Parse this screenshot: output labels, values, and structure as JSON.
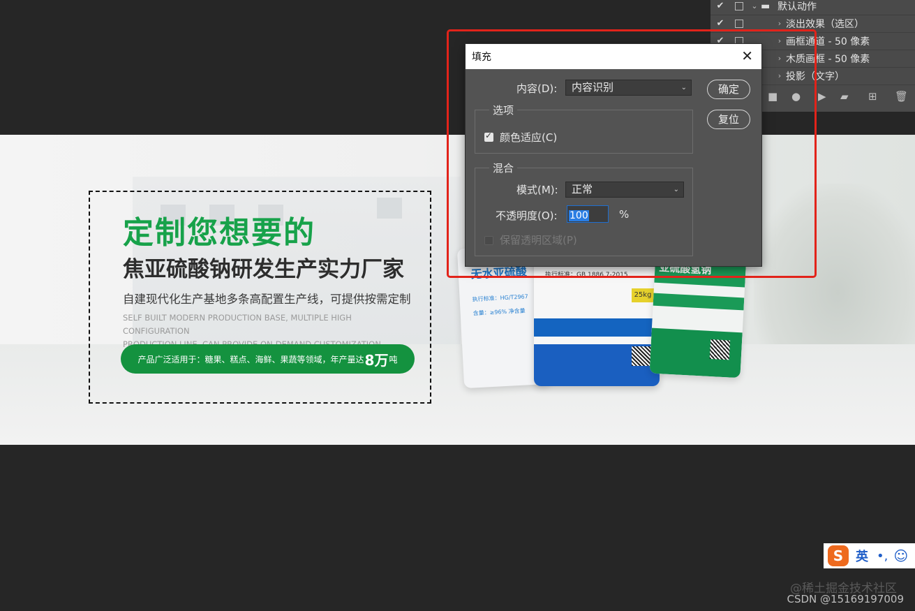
{
  "actions_panel": {
    "rows": [
      {
        "name": "默认动作",
        "kind": "folder"
      },
      {
        "name": "淡出效果（选区）",
        "kind": "action"
      },
      {
        "name": "画框通道 - 50 像素",
        "kind": "action"
      },
      {
        "name": "木质画框 - 50 像素",
        "kind": "action"
      },
      {
        "name": "投影（文字）",
        "kind": "action"
      }
    ],
    "check_mark": "✔"
  },
  "dialog": {
    "title": "填充",
    "close_glyph": "✕",
    "content_label": "内容(D):",
    "content_value": "内容识别",
    "ok_label": "确定",
    "reset_label": "复位",
    "options_title": "选项",
    "color_adapt_label": "颜色适应(C)",
    "color_adapt_checked": true,
    "blend_title": "混合",
    "mode_label": "模式(M):",
    "mode_value": "正常",
    "opacity_label": "不透明度(O):",
    "opacity_value": "100",
    "opacity_unit": "%",
    "preserve_label": "保留透明区域(P)",
    "preserve_checked": false,
    "preserve_enabled": false
  },
  "banner": {
    "headline": "定制您想要的",
    "subhead": "焦亚硫酸钠研发生产实力厂家",
    "desc": "自建现代化生产基地多条高配置生产线，可提供按需定制",
    "en_line1": "SELF BUILT MODERN PRODUCTION BASE, MULTIPLE HIGH CONFIGURATION",
    "en_line2": "PRODUCTION LINE, CAN PROVIDE ON-DEMAND CUSTOMIZATION.",
    "pill_prefix": "产品广泛适用于：糖果、糕点、海鲜、果蔬等领域，年产量达",
    "pill_number": "8万",
    "pill_suffix": "吨",
    "bag1_title": "无水亚硫酸",
    "bag1_line1": "执行标准：HG/T2967",
    "bag1_line2": "含量：≥96%  净含量",
    "bag2_std": "执行标准：GB 1886.7-2015",
    "bag2_tag": "25kg",
    "bag3_title": "亚硫酸氢钠"
  },
  "ime": {
    "logo": "S",
    "lang": "英",
    "punc": "•,",
    "emoji": "☺"
  },
  "watermark": {
    "line1": "@稀土掘金技术社区",
    "line2": "CSDN @15169197009"
  },
  "colors": {
    "accent_green": "#17a24a",
    "highlight_red": "#e2231a",
    "dialog_bg": "#535353"
  }
}
